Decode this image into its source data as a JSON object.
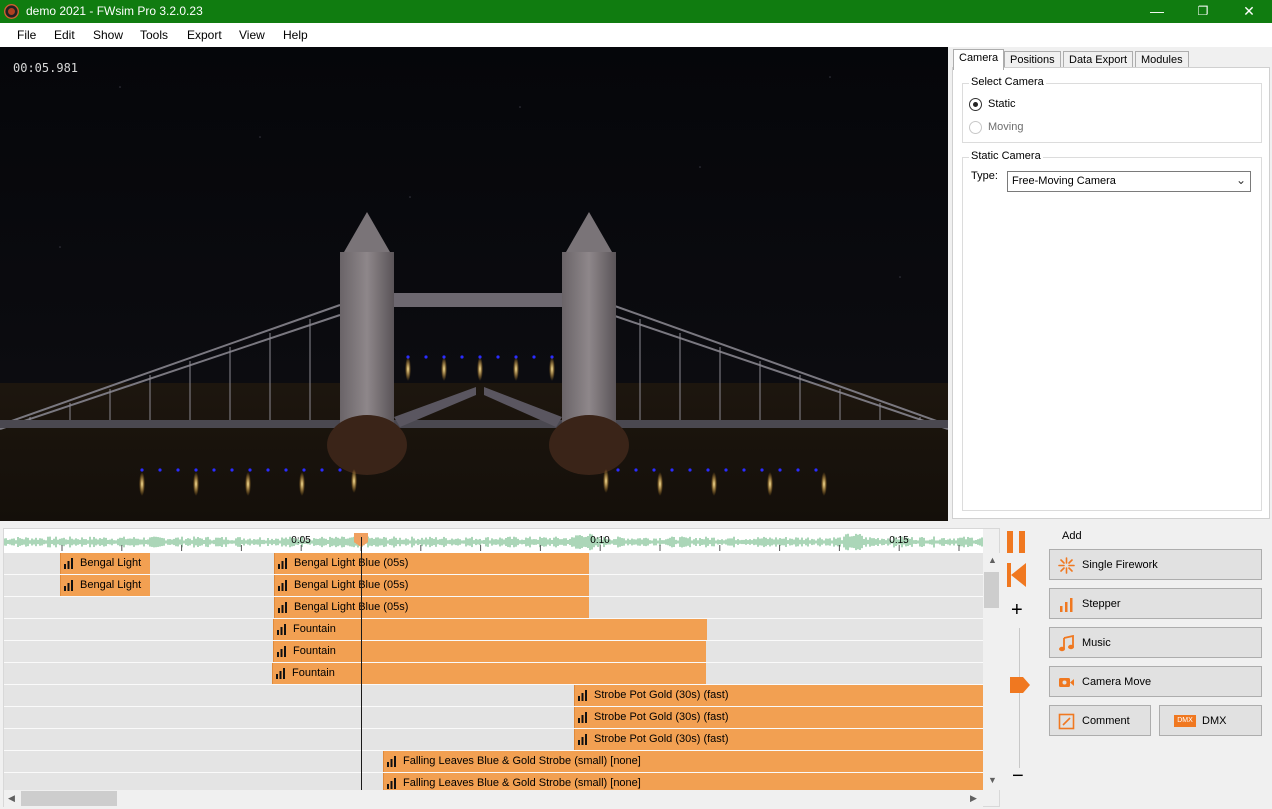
{
  "window": {
    "title": "demo 2021 - FWsim Pro 3.2.0.23",
    "minimize": "—",
    "maximize": "❐",
    "close": "✕"
  },
  "menu": [
    "File",
    "Edit",
    "Show",
    "Tools",
    "Export",
    "View",
    "Help"
  ],
  "viewport": {
    "timecode": "00:05.981"
  },
  "sidepanel": {
    "tabs": [
      "Camera",
      "Positions",
      "Data Export",
      "Modules"
    ],
    "active_tab": "Camera",
    "select_camera": {
      "title": "Select Camera",
      "options": [
        "Static",
        "Moving"
      ],
      "selected": "Static"
    },
    "static_camera": {
      "title": "Static Camera",
      "type_label": "Type:",
      "type_value": "Free-Moving Camera"
    }
  },
  "timeline": {
    "ruler_labels": [
      "0:05",
      "0:10",
      "0:15"
    ],
    "clips": [
      {
        "label": "Bengal Light"
      },
      {
        "label": "Bengal Light Blue (05s)"
      },
      {
        "label": "Bengal Light"
      },
      {
        "label": "Bengal Light Blue (05s)"
      },
      {
        "label": "Bengal Light Blue (05s)"
      },
      {
        "label": "Fountain"
      },
      {
        "label": "Fountain"
      },
      {
        "label": "Fountain"
      },
      {
        "label": "Strobe Pot Gold (30s) (fast)"
      },
      {
        "label": "Strobe Pot Gold (30s) (fast)"
      },
      {
        "label": "Strobe Pot Gold (30s) (fast)"
      },
      {
        "label": "Falling Leaves Blue & Gold Strobe (small) [none]"
      },
      {
        "label": "Falling Leaves Blue & Gold Strobe (small) [none]"
      }
    ]
  },
  "controls": {
    "zoom_in": "+",
    "zoom_out": "−"
  },
  "add_panel": {
    "title": "Add",
    "buttons": {
      "single_firework": "Single Firework",
      "stepper": "Stepper",
      "music": "Music",
      "camera_move": "Camera Move",
      "comment": "Comment",
      "dmx": "DMX"
    },
    "dmx_badge": "DMX"
  },
  "colors": {
    "titlebar": "#107c10",
    "accent_orange": "#f07820",
    "clip": "#f2a052",
    "waveform": "#8fc9a0"
  }
}
